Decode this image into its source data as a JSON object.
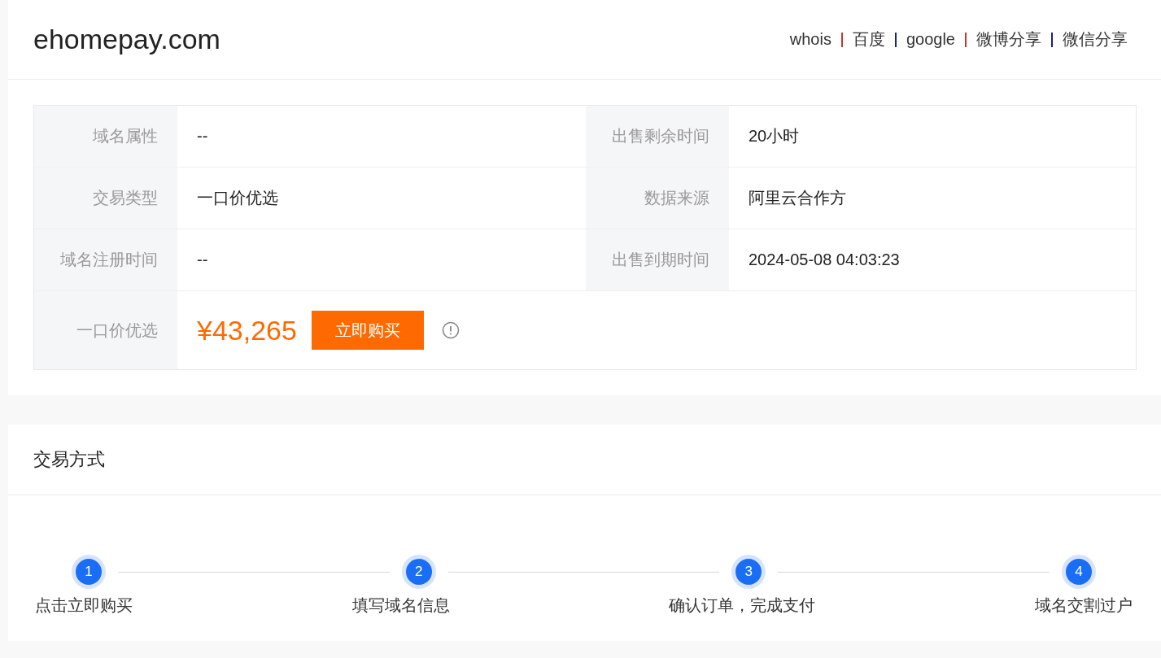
{
  "domain": "ehomepay.com",
  "links": [
    {
      "label": "whois"
    },
    {
      "label": "百度"
    },
    {
      "label": "google"
    },
    {
      "label": "微博分享"
    },
    {
      "label": "微信分享"
    }
  ],
  "link_separators": [
    {
      "color": "#c0392b"
    },
    {
      "color": "#1a237e"
    },
    {
      "color": "#c0392b"
    },
    {
      "color": "#1a237e"
    }
  ],
  "info_rows": [
    {
      "label": "域名属性",
      "value": "--",
      "label_2": "出售剩余时间",
      "value_2": "20小时"
    },
    {
      "label": "交易类型",
      "value": "一口价优选",
      "label_2": "数据来源",
      "value_2": "阿里云合作方"
    },
    {
      "label": "域名注册时间",
      "value": "--",
      "label_2": "出售到期时间",
      "value_2": "2024-05-08 04:03:23"
    }
  ],
  "price_row": {
    "label": "一口价优选",
    "price": "¥43,265",
    "buy_button": "立即购买"
  },
  "trade_section": {
    "title": "交易方式",
    "steps": [
      {
        "number": "1",
        "label": "点击立即购买"
      },
      {
        "number": "2",
        "label": "填写域名信息"
      },
      {
        "number": "3",
        "label": "确认订单，完成支付"
      },
      {
        "number": "4",
        "label": "域名交割过户"
      }
    ]
  }
}
